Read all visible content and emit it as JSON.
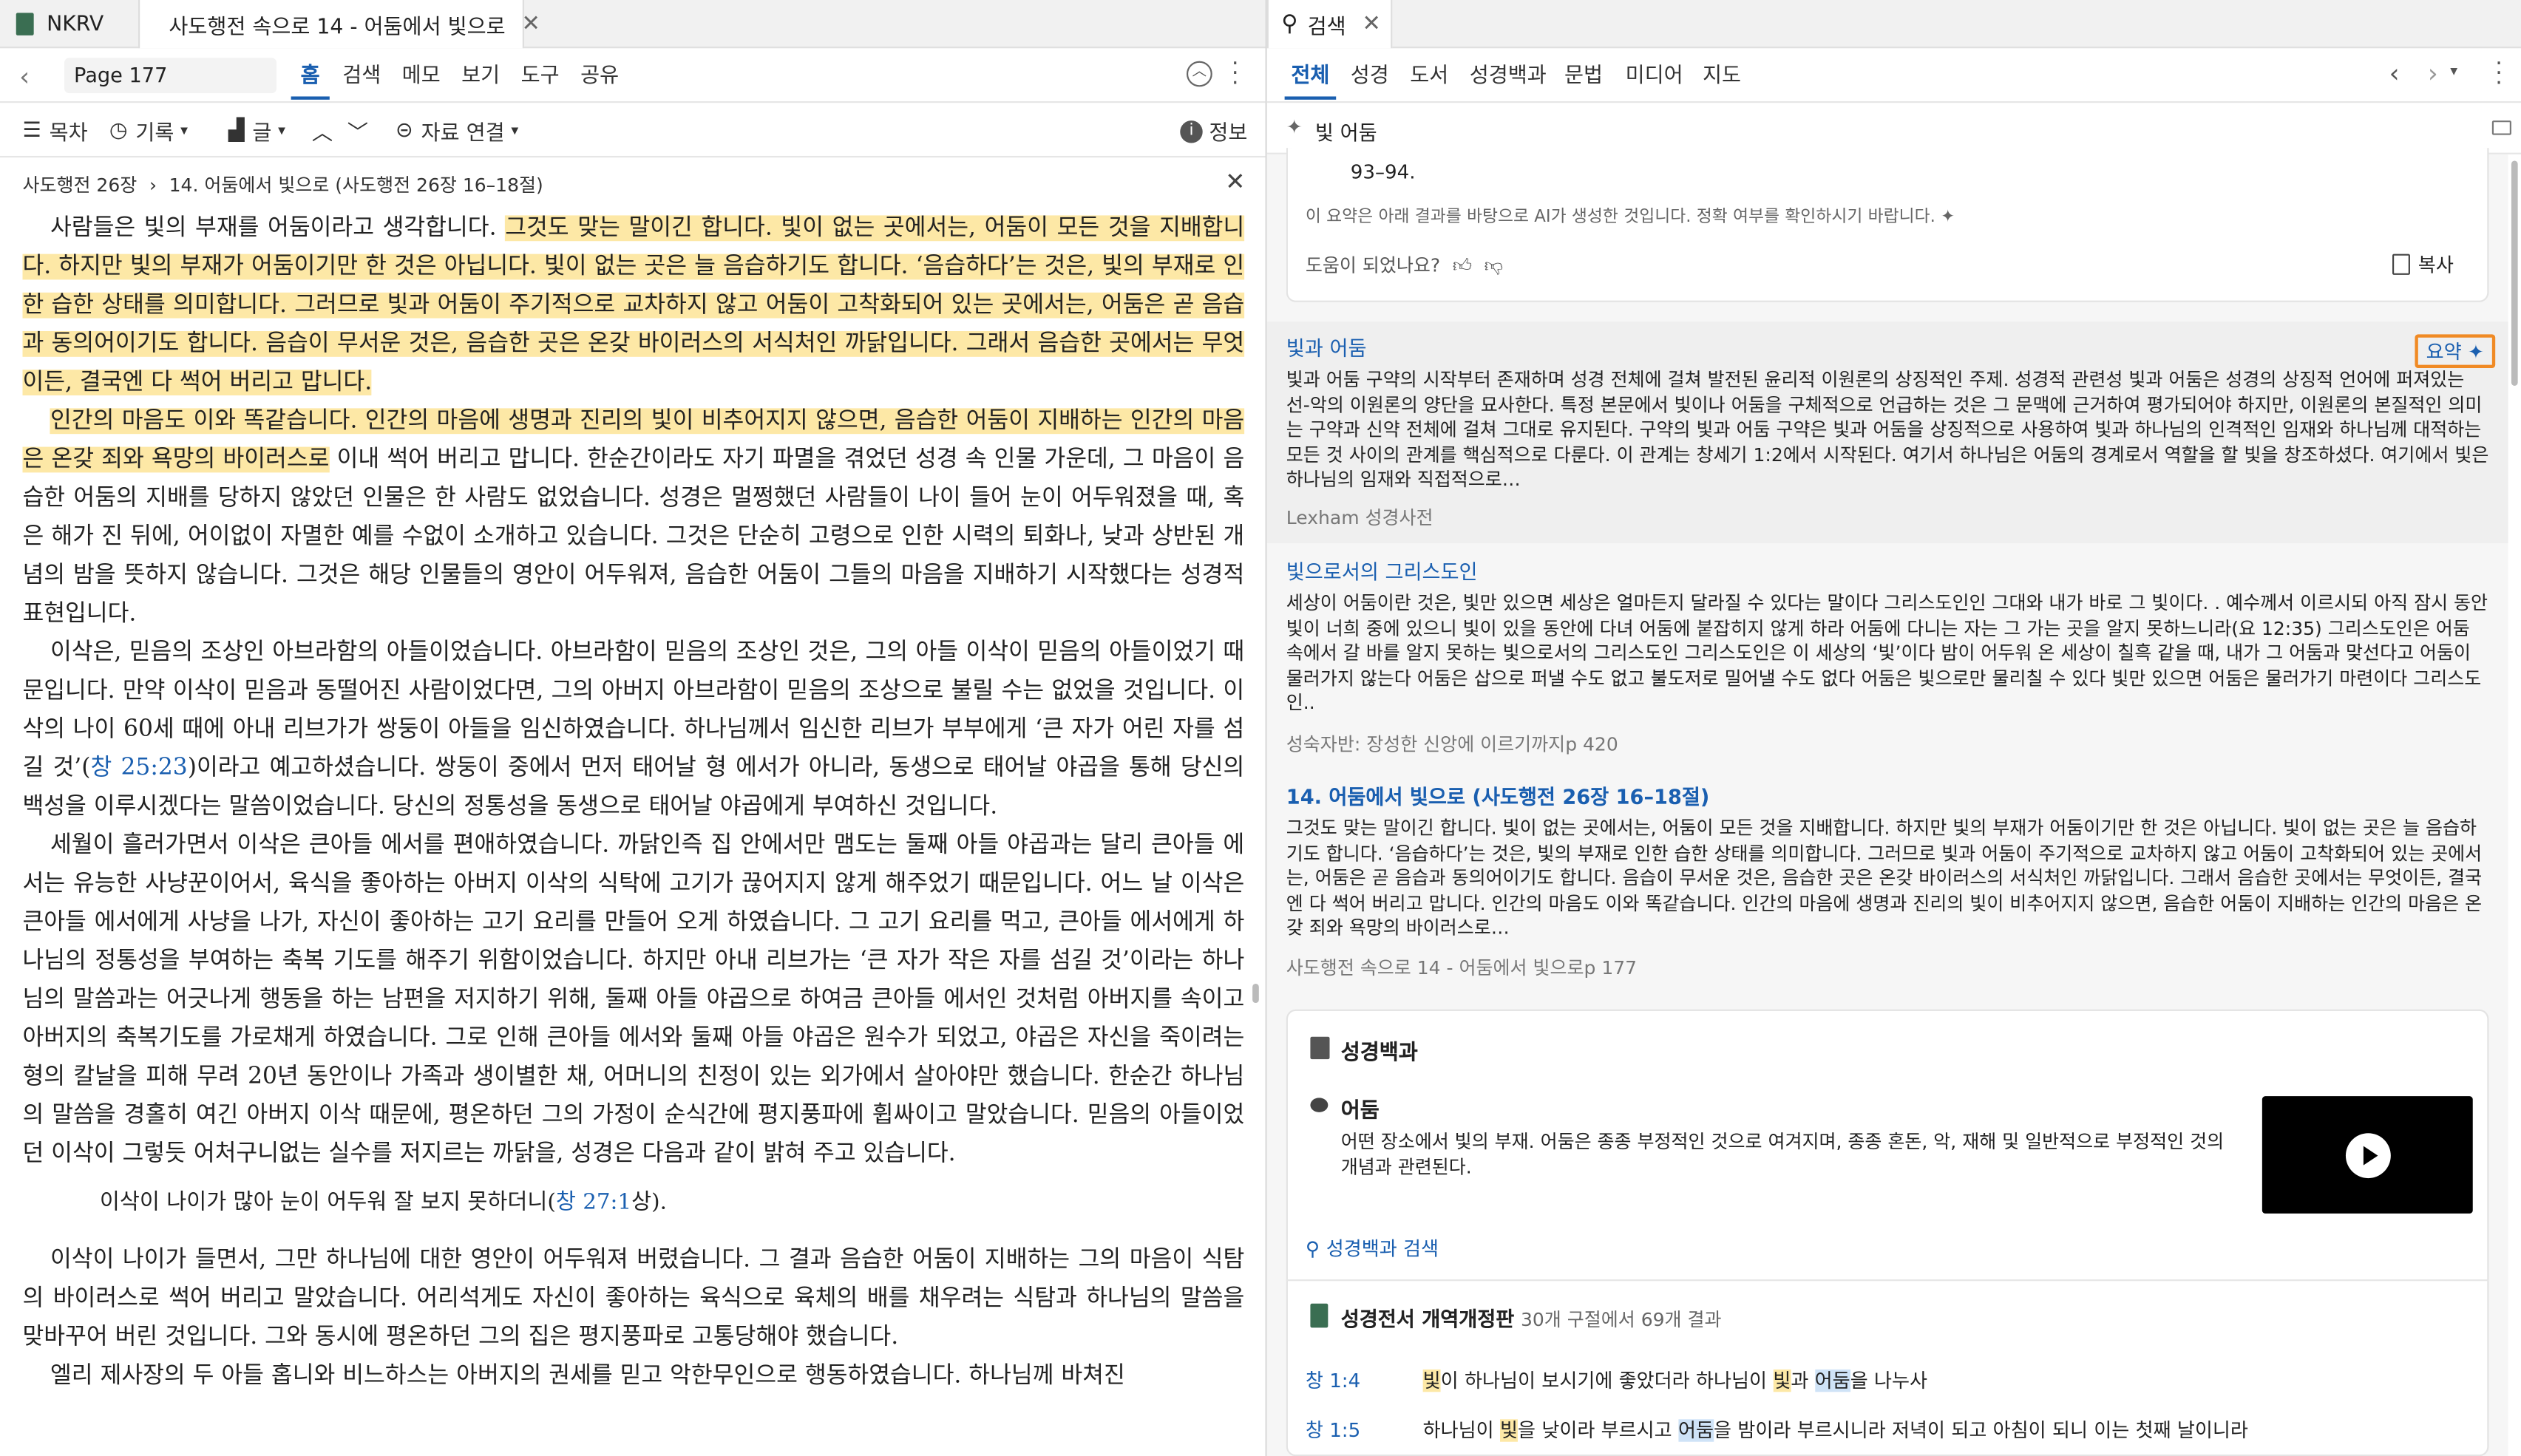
{
  "left_tabs": {
    "tab1": "NKRV",
    "tab2": "사도행전 속으로 14 - 어둠에서 빛으로"
  },
  "right_tabs": {
    "search": "검색"
  },
  "left_nav": {
    "page": "Page 177",
    "menu": [
      "홈",
      "검색",
      "메모",
      "보기",
      "도구",
      "공유"
    ]
  },
  "left_toolbar": {
    "toc": "목차",
    "history": "기록",
    "text": "글",
    "link": "자료 연결",
    "info": "정보"
  },
  "breadcrumb": {
    "book": "사도행전 26장",
    "sep": "›",
    "chapter": "14. 어둠에서 빛으로 (사도행전 26장 16–18절)"
  },
  "reader": {
    "p1a": "사람들은 빛의 부재를 어둠이라고 생각합니다. ",
    "p1b": "그것도 맞는 말이긴 합니다. 빛이 없는 곳에서는, 어둠이 모든 것을 지배합니다. 하지만 빛의 부재가 어둠이기만 한 것은 아닙니다. 빛이 없는 곳은 늘 음습하기도 합니다. ‘음습하다’는 것은, 빛의 부재로 인한 습한 상태를 의미합니다. 그러므로 빛과 어둠이 주기적으로 교차하지 않고 어둠이 고착화되어 있는 곳에서는, 어둠은 곧 음습과 동의어이기도 합니다. 음습이 무서운 것은, 음습한 곳은 온갖 바이러스의 서식처인 까닭입니다. 그래서 음습한 곳에서는 무엇이든, 결국엔 다 썩어 버리고 맙니다.",
    "p2a": "인간의 마음도 이와 똑같습니다. 인간의 마음에 생명과 진리의 빛이 비추어지지 않으면, 음습한 어둠이 지배하는 인간의 마음은 온갖 죄와 욕망의 바이러스로",
    "p2b": " 이내 썩어 버리고 맙니다. 한순간이라도 자기 파멸을 겪었던 성경 속 인물 가운데, 그 마음이 음습한 어둠의 지배를 당하지 않았던 인물은 한 사람도 없었습니다. 성경은 멀쩡했던 사람들이 나이 들어 눈이 어두워졌을 때, 혹은 해가 진 뒤에, 어이없이 자멸한 예를 수없이 소개하고 있습니다. 그것은 단순히 고령으로 인한 시력의 퇴화나, 낮과 상반된 개념의 밤을 뜻하지 않습니다. 그것은 해당 인물들의 영안이 어두워져, 음습한 어둠이 그들의 마음을 지배하기 시작했다는 성경적 표현입니다.",
    "p3a": "이삭은, 믿음의 조상인 아브라함의 아들이었습니다. 아브라함이 믿음의 조상인 것은, 그의 아들 이삭이 믿음의 아들이었기 때문입니다. 만약 이삭이 믿음과 동떨어진 사람이었다면, 그의 아버지 아브라함이 믿음의 조상으로 불릴 수는 없었을 것입니다. 이삭의 나이 60세 때에 아내 리브가가 쌍둥이 아들을 임신하였습니다. 하나님께서 임신한 리브가 부부에게 ‘큰 자가 어린 자를 섬길 것’(",
    "p3ref": "창 25:23",
    "p3b": ")이라고 예고하셨습니다. 쌍둥이 중에서 먼저 태어날 형 에서가 아니라, 동생으로 태어날 야곱을 통해 당신의 백성을 이루시겠다는 말씀이었습니다. 당신의 정통성을 동생으로 태어날 야곱에게 부여하신 것입니다.",
    "p4": "세월이 흘러가면서 이삭은 큰아들 에서를 편애하였습니다. 까닭인즉 집 안에서만 맴도는 둘째 아들 야곱과는 달리 큰아들 에서는 유능한 사냥꾼이어서, 육식을 좋아하는 아버지 이삭의 식탁에 고기가 끊어지지 않게 해주었기 때문입니다. 어느 날 이삭은 큰아들 에서에게 사냥을 나가, 자신이 좋아하는 고기 요리를 만들어 오게 하였습니다. 그 고기 요리를 먹고, 큰아들 에서에게 하나님의 정통성을 부여하는 축복 기도를 해주기 위함이었습니다. 하지만 아내 리브가는 ‘큰 자가 작은 자를 섬길 것’이라는 하나님의 말씀과는 어긋나게 행동을 하는 남편을 저지하기 위해, 둘째 아들 야곱으로 하여금 큰아들 에서인 것처럼 아버지를 속이고 아버지의 축복기도를 가로채게 하였습니다. 그로 인해 큰아들 에서와 둘째 아들 야곱은 원수가 되었고, 야곱은 자신을 죽이려는 형의 칼날을 피해 무려 20년 동안이나 가족과 생이별한 채, 어머니의 친정이 있는 외가에서 살아야만 했습니다. 한순간 하나님의 말씀을 경홀히 여긴 아버지 이삭 때문에, 평온하던 그의 가정이 순식간에 평지풍파에 휩싸이고 말았습니다. 믿음의 아들이었던 이삭이 그렇듯 어처구니없는 실수를 저지르는 까닭을, 성경은 다음과 같이 밝혀 주고 있습니다.",
    "quote_a": "이삭이 나이가 많아 눈이 어두워 잘 보지 못하더니(",
    "quote_ref": "창 27:1",
    "quote_b": "상).",
    "p5": "이삭이 나이가 들면서, 그만 하나님에 대한 영안이 어두워져 버렸습니다. 그 결과 음습한 어둠이 지배하는 그의 마음이 식탐의 바이러스로 썩어 버리고 말았습니다. 어리석게도 자신이 좋아하는 육식으로 육체의 배를 채우려는 식탐과 하나님의 말씀을 맞바꾸어 버린 것입니다. 그와 동시에 평온하던 그의 집은 평지풍파로 고통당해야 했습니다.",
    "p6": "엘리 제사장의 두 아들 홉니와 비느하스는 아버지의 권세를 믿고 악한무인으로 행동하였습니다. 하나님께 바쳐진"
  },
  "right_nav": {
    "tabs": [
      "전체",
      "성경",
      "도서",
      "성경백과",
      "문법",
      "미디어",
      "지도"
    ]
  },
  "search_query": "빛 어둠",
  "ai_card": {
    "pages": "93–94.",
    "note": "이 요약은 아래 결과를 바탕으로 AI가 생성한 것입니다. 정확 여부를 확인하시기 바랍니다.",
    "helpful": "도움이 되었나요?",
    "copy": "복사"
  },
  "results": [
    {
      "title": "빛과 어둠",
      "summary_btn": "요약",
      "body": "빛과 어둠 구약의 시작부터 존재하며 성경 전체에 걸쳐 발전된 윤리적 이원론의 상징적인 주제. 성경적 관련성 빛과 어둠은 성경의 상징적 언어에 퍼져있는 선-악의 이원론의 양단을 묘사한다. 특정 본문에서 빛이나 어둠을 구체적으로 언급하는 것은 그 문맥에 근거하여 평가되어야 하지만, 이원론의 본질적인 의미는 구약과 신약 전체에 걸쳐 그대로 유지된다. 구약의 빛과 어둠 구약은 빛과 어둠을 상징적으로 사용하여 빛과 하나님의 인격적인 임재와 하나님께 대적하는 모든 것 사이의 관계를 핵심적으로 다룬다. 이 관계는 창세기 1:2에서 시작된다. 여기서 하나님은 어둠의 경계로서 역할을 할 빛을 창조하셨다. 여기에서 빛은 하나님의 임재와 직접적으로…",
      "source": "Lexham 성경사전"
    },
    {
      "title": "빛으로서의 그리스도인",
      "body": "세상이 어둠이란 것은, 빛만 있으면 세상은 얼마든지 달라질 수 있다는 말이다 그리스도인인 그대와 내가 바로 그 빛이다. . 예수께서 이르시되 아직 잠시 동안 빛이 너희 중에 있으니 빛이 있을 동안에 다녀 어둠에 붙잡히지 않게 하라 어둠에 다니는 자는 그 가는 곳을 알지 못하느니라(요 12:35) 그리스도인은 어둠 속에서 갈 바를 알지 못하는 빛으로서의 그리스도인 그리스도인은 이 세상의 ‘빛’이다 밤이 어두워 온 세상이 칠흑 같을 때, 내가 그 어둠과 맞선다고 어둠이 물러가지 않는다 어둠은 삽으로 퍼낼 수도 없고 불도저로 밀어낼 수도 없다 어둠은 빛으로만 물리칠 수 있다 빛만 있으면 어둠은 물러가기 마련이다 그리스도인..",
      "source": "성숙자반: 장성한 신앙에 이르기까지p 420"
    },
    {
      "title": "14. 어둠에서 빛으로 (사도행전 26장 16–18절)",
      "body": "그것도 맞는 말이긴 합니다. 빛이 없는 곳에서는, 어둠이 모든 것을 지배합니다. 하지만 빛의 부재가 어둠이기만 한 것은 아닙니다. 빛이 없는 곳은 늘 음습하기도 합니다. ‘음습하다’는 것은, 빛의 부재로 인한 습한 상태를 의미합니다. 그러므로 빛과 어둠이 주기적으로 교차하지 않고 어둠이 고착화되어 있는 곳에서는, 어둠은 곧 음습과 동의어이기도 합니다. 음습이 무서운 것은, 음습한 곳은 온갖 바이러스의 서식처인 까닭입니다. 그래서 음습한 곳에서는 무엇이든, 결국엔 다 썩어 버리고 맙니다. 인간의 마음도 이와 똑같습니다. 인간의 마음에 생명과 진리의 빛이 비추어지지 않으면, 음습한 어둠이 지배하는 인간의 마음은 온갖 죄와 욕망의 바이러스로…",
      "source": "사도행전 속으로 14 - 어둠에서 빛으로p 177"
    }
  ],
  "encyclopedia": {
    "header": "성경백과",
    "term": "어둠",
    "desc": "어떤 장소에서 빛의 부재. 어둠은 종종 부정적인 것으로 여겨지며, 종종 혼돈, 악, 재해 및 일반적으로 부정적인 것의 개념과 관련된다.",
    "search_link": "성경백과 검색"
  },
  "bible_results": {
    "title": "성경전서 개역개정판",
    "count": "30개 구절에서 69개 결과",
    "verses": [
      {
        "ref": "창 1:4",
        "t1": "",
        "h1": "빛",
        "t2": "이 하나님이 보시기에 좋았더라 하나님이 ",
        "h2": "빛",
        "t3": "과 ",
        "b1": "어둠",
        "t4": "을 나누사"
      },
      {
        "ref": "창 1:5",
        "t1": "하나님이 ",
        "h1": "빛",
        "t2": "을 낮이라 부르시고 ",
        "h2": "",
        "t3": "",
        "b1": "어둠",
        "t4": "을 밤이라 부르시니라 저녁이 되고 아침이 되니 이는 첫째 날이니라"
      }
    ]
  },
  "colors": {
    "accent": "#1a5fb0",
    "highlight": "#fde8a6",
    "orange": "#f08a24"
  }
}
